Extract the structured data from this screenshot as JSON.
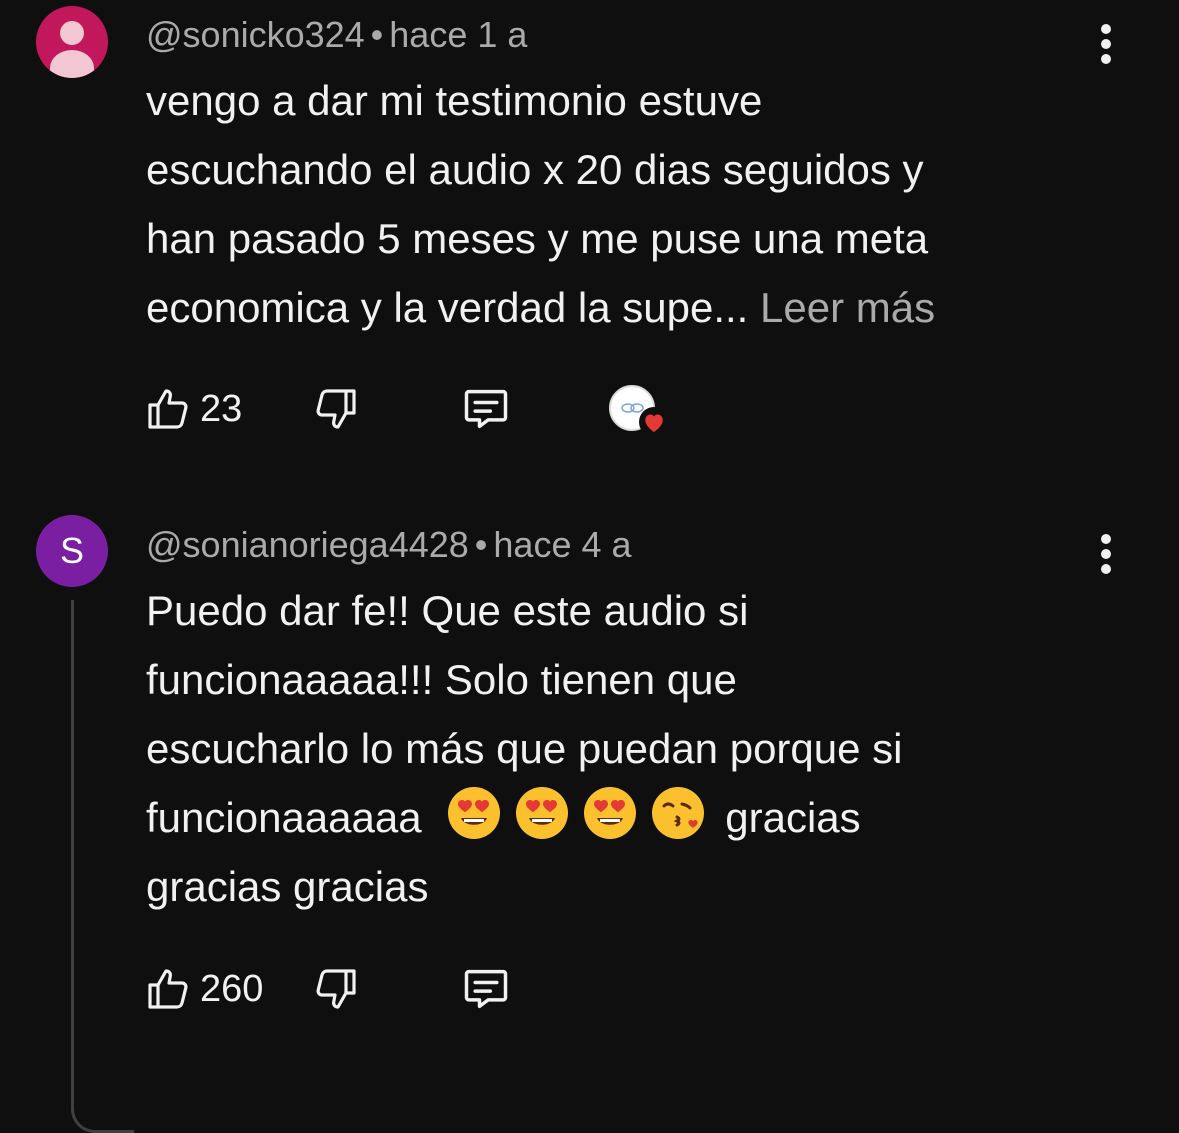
{
  "comments": [
    {
      "handle": "@sonicko324",
      "separator": "•",
      "time": "hace 1 a",
      "avatar_type": "default-person",
      "lines": [
        "vengo a dar mi testimonio estuve",
        "escuchando el audio x 20 dias seguidos y",
        "han pasado 5 meses y me puse una meta",
        "economica y la verdad la supe..."
      ],
      "read_more": "Leer más",
      "likes": "23",
      "creator_heart": true
    },
    {
      "handle": "@sonianoriega4428",
      "separator": "•",
      "time": "hace 4 a",
      "avatar_letter": "S",
      "lines": [
        "Puedo dar fe!! Que este audio si",
        "funcionaaaaa!!! Solo tienen que",
        "escucharlo lo más que puedan porque si",
        "funcionaaaaaa",
        "gracias gracias"
      ],
      "emojis": [
        "heart-eyes-emoji",
        "heart-eyes-emoji",
        "heart-eyes-emoji",
        "kissing-face-emoji"
      ],
      "line4_tail": "gracias",
      "likes": "260"
    }
  ],
  "icons": {
    "like": "thumb-up-icon",
    "dislike": "thumb-down-icon",
    "reply": "comment-icon",
    "more": "more-vert-icon",
    "heart": "heart-icon"
  },
  "colors": {
    "background": "#0f0f0f",
    "text": "#f1f1f1",
    "secondary_text": "#aaaaaa",
    "avatar1": "#c2185b",
    "avatar2": "#7b1fa2",
    "heart": "#e53935"
  }
}
